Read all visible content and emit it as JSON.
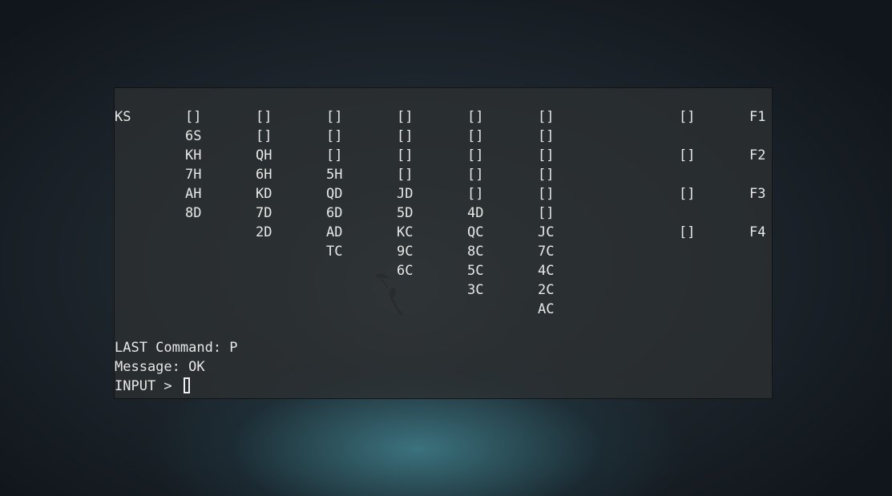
{
  "board": {
    "stock": "KS",
    "columns": [
      [
        "[]",
        "6S",
        "KH",
        "7H",
        "AH",
        "8D"
      ],
      [
        "[]",
        "[]",
        "QH",
        "6H",
        "KD",
        "7D",
        "2D"
      ],
      [
        "[]",
        "[]",
        "[]",
        "5H",
        "QD",
        "6D",
        "AD",
        "TC"
      ],
      [
        "[]",
        "[]",
        "[]",
        "[]",
        "JD",
        "5D",
        "KC",
        "9C",
        "6C"
      ],
      [
        "[]",
        "[]",
        "[]",
        "[]",
        "[]",
        "4D",
        "QC",
        "8C",
        "5C",
        "3C"
      ],
      [
        "[]",
        "[]",
        "[]",
        "[]",
        "[]",
        "[]",
        "JC",
        "7C",
        "4C",
        "2C",
        "AC"
      ]
    ],
    "foundations": [
      {
        "slot": "[]",
        "label": "F1"
      },
      {
        "slot": "[]",
        "label": "F2"
      },
      {
        "slot": "[]",
        "label": "F3"
      },
      {
        "slot": "[]",
        "label": "F4"
      }
    ]
  },
  "status": {
    "last_command": "LAST Command: P",
    "message": "Message: OK",
    "prompt": "INPUT > "
  }
}
